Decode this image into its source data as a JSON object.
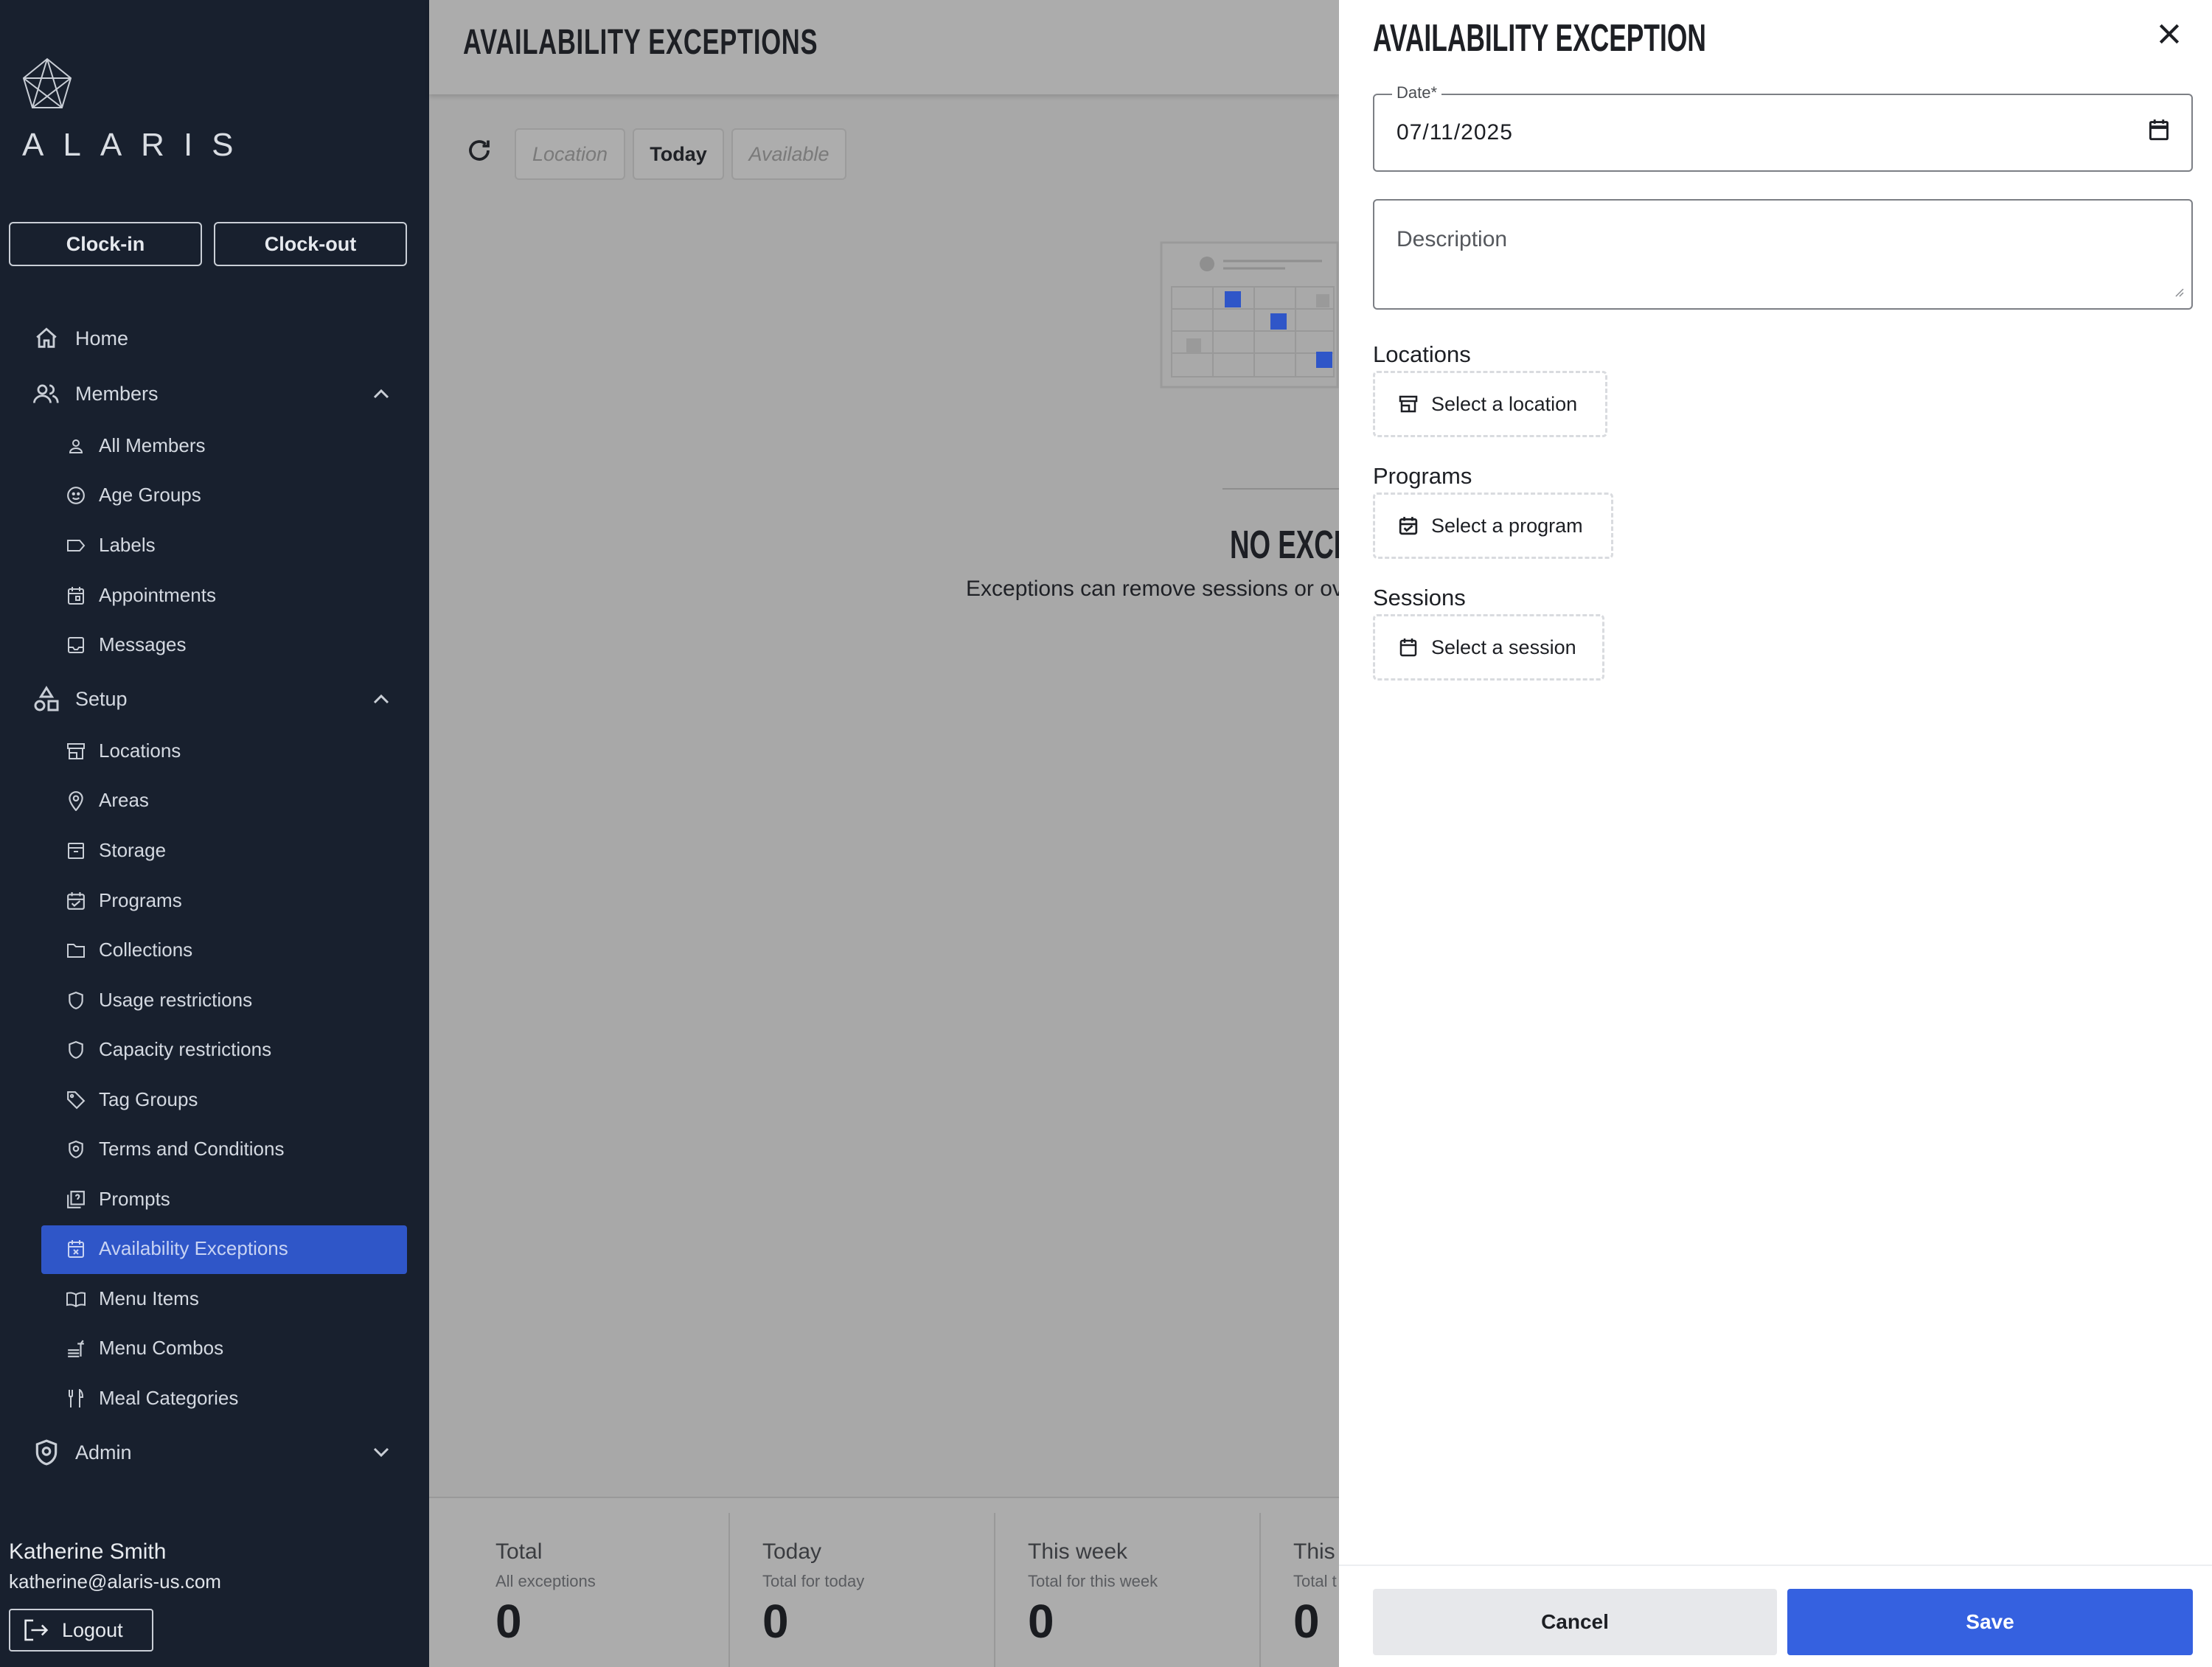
{
  "app": {
    "brand": "ALARIS"
  },
  "sidebar": {
    "clock_in_label": "Clock-in",
    "clock_out_label": "Clock-out",
    "home": "Home",
    "members": "Members",
    "members_items": [
      "All Members",
      "Age Groups",
      "Labels",
      "Appointments",
      "Messages"
    ],
    "setup": "Setup",
    "setup_items": [
      "Locations",
      "Areas",
      "Storage",
      "Programs",
      "Collections",
      "Usage restrictions",
      "Capacity restrictions",
      "Tag Groups",
      "Terms and Conditions",
      "Prompts",
      "Availability Exceptions",
      "Menu Items",
      "Menu Combos",
      "Meal Categories"
    ],
    "admin": "Admin",
    "active_item": "Availability Exceptions",
    "user": {
      "name": "Katherine Smith",
      "email": "katherine@alaris-us.com"
    },
    "logout_label": "Logout"
  },
  "main": {
    "title": "AVAILABILITY EXCEPTIONS",
    "filters": {
      "location": "Location",
      "today": "Today",
      "available": "Available"
    },
    "empty_title": "NO EXCEI",
    "empty_desc": "Exceptions can remove sessions or ov",
    "stats": [
      {
        "title": "Total",
        "subtitle": "All exceptions",
        "value": "0"
      },
      {
        "title": "Today",
        "subtitle": "Total for today",
        "value": "0"
      },
      {
        "title": "This week",
        "subtitle": "Total for this week",
        "value": "0"
      },
      {
        "title": "This",
        "subtitle": "Total t",
        "value": "0"
      }
    ]
  },
  "drawer": {
    "title": "AVAILABILITY EXCEPTION",
    "date": {
      "label": "Date*",
      "value": "07/11/2025"
    },
    "description": {
      "placeholder": "Description"
    },
    "locations": {
      "label": "Locations",
      "button": "Select a location"
    },
    "programs": {
      "label": "Programs",
      "button": "Select a program"
    },
    "sessions": {
      "label": "Sessions",
      "button": "Select a session"
    },
    "cancel_label": "Cancel",
    "save_label": "Save"
  },
  "colors": {
    "sidebar_bg": "#18202e",
    "active": "#2f56c8",
    "primary": "#3561e0",
    "overlay": "#a8a8a8"
  }
}
